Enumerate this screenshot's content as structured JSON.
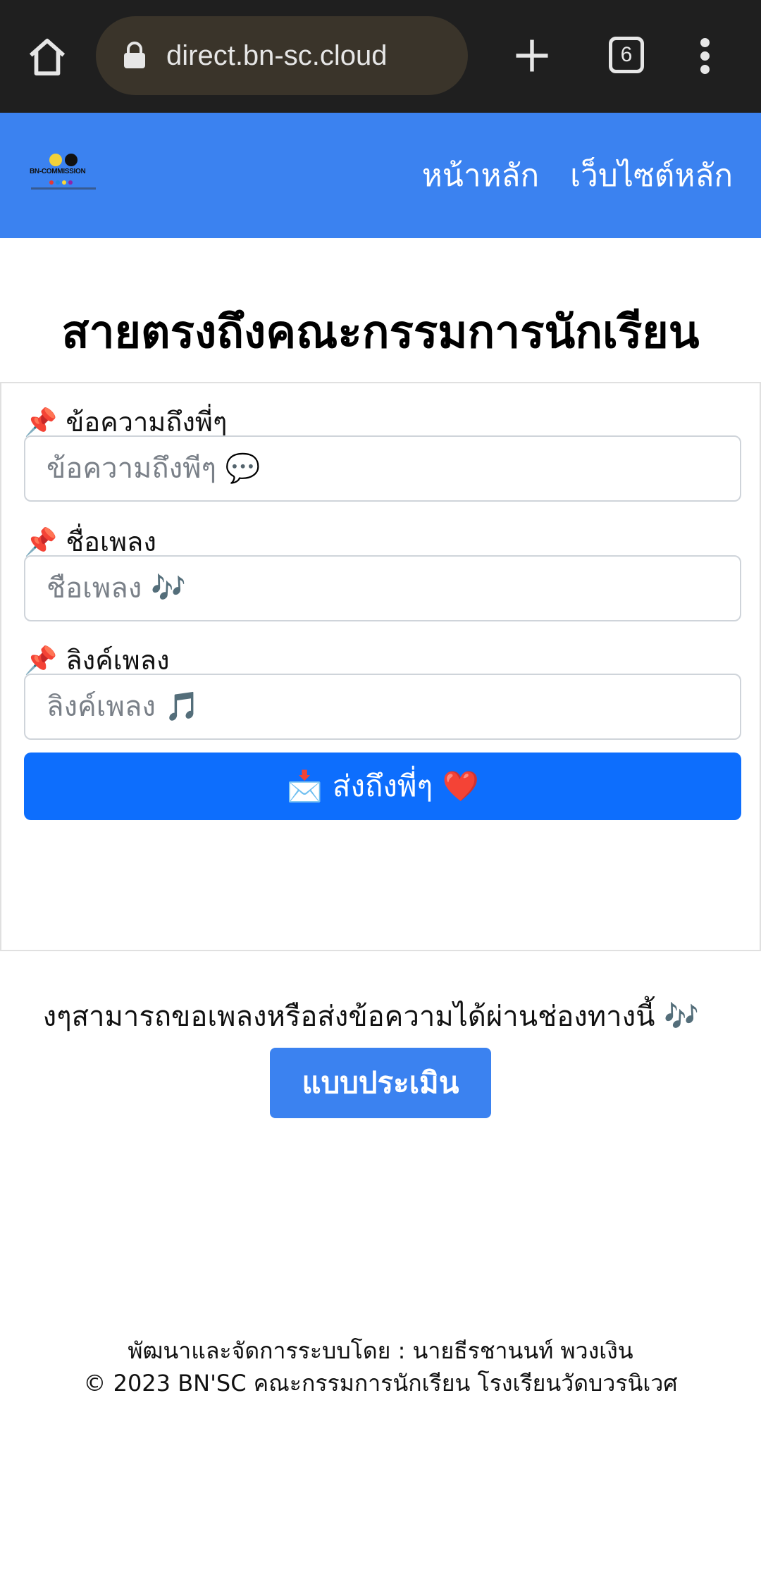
{
  "browser": {
    "url": "direct.bn-sc.cloud",
    "tab_count": "6"
  },
  "navbar": {
    "logo_text": "BN-COMMISSION",
    "links": [
      "หน้าหลัก",
      "เว็บไซต์หลัก"
    ]
  },
  "page": {
    "title": "สายตรงถึงคณะกรรมการนักเรียน"
  },
  "form": {
    "fields": [
      {
        "label": "📌 ข้อความถึงพี่ๆ",
        "placeholder": "ข้อความถึงพีๆ 💬",
        "value": ""
      },
      {
        "label": "📌 ชื่อเพลง",
        "placeholder": "ชือเพลง 🎶",
        "value": ""
      },
      {
        "label": "📌 ลิงค์เพลง",
        "placeholder": "ลิงค์เพลง 🎵",
        "value": ""
      }
    ],
    "submit_label": "📩 ส่งถึงพี่ๆ ❤️"
  },
  "info": {
    "text": "งๆสามารถขอเพลงหรือส่งข้อความได้ผ่านช่องทางนี้ 🎶"
  },
  "eval_button": "แบบประเมิน",
  "footer": {
    "developer": "พัฒนาและจัดการระบบโดย : นายธีรชานนท์ พวงเงิน",
    "copyright": "© 2023 BN'SC คณะกรรมการนักเรียน โรงเรียนวัดบวรนิเวศ"
  },
  "colors": {
    "navbar": "#3b82f0",
    "submit": "#0d6efd",
    "browser_bar": "#1f1f1f"
  }
}
